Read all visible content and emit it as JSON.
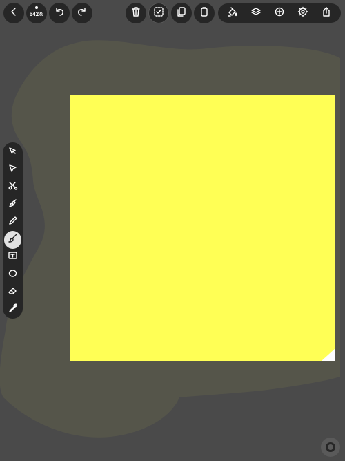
{
  "top_bar": {
    "zoom_label": "642%"
  },
  "canvas": {
    "background_color": "#4a4a4a",
    "artboard_color": "#ffff55",
    "stroke_color": "#55554a"
  },
  "icons": {
    "back": "chevron-left-icon",
    "undo": "undo-icon",
    "redo": "redo-icon",
    "trash": "trash-icon",
    "select_all": "select-all-icon",
    "duplicate": "duplicate-icon",
    "paste": "clipboard-icon",
    "style": "paint-bucket-icon",
    "layers": "layers-icon",
    "add": "plus-circle-icon",
    "settings": "gear-icon",
    "share": "share-icon"
  },
  "tools": [
    "selection-arrow-tool",
    "direct-select-tool",
    "scissors-tool",
    "pen-tool",
    "pencil-tool",
    "brush-tool",
    "text-tool",
    "ellipse-tool",
    "eraser-tool",
    "eyedropper-tool"
  ],
  "active_tool": "brush-tool"
}
